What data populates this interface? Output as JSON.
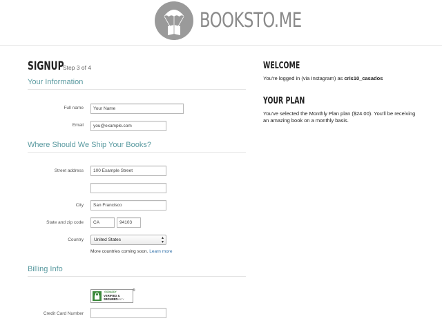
{
  "brand": {
    "name": "BOOKSTO.ME",
    "top_right": "' ' '"
  },
  "signup": {
    "title": "SIGNUP",
    "step": "Step 3 of 4"
  },
  "sections": {
    "info": "Your Information",
    "ship": "Where Should We Ship Your Books?",
    "billing": "Billing Info"
  },
  "fields": {
    "full_name": {
      "label": "Full name",
      "placeholder": "Your Name"
    },
    "email": {
      "label": "Email",
      "placeholder": "you@example.com"
    },
    "street": {
      "label": "Street address",
      "placeholder": "100 Example Street",
      "placeholder2": ""
    },
    "city": {
      "label": "City",
      "placeholder": "San Francisco"
    },
    "state_zip": {
      "label": "State and zip code",
      "state_placeholder": "CA",
      "zip_placeholder": "94103"
    },
    "country": {
      "label": "Country",
      "value": "United States"
    },
    "country_note": "More countries coming soon.",
    "learn_more": "Learn more",
    "card_number": {
      "label": "Credit Card Number",
      "placeholder": ""
    }
  },
  "badge": {
    "line1": "GODADDY",
    "line2": "VERIFIED & SECURED",
    "line3": "VERIFY SECURITY",
    "reg": "®"
  },
  "welcome": {
    "title": "WELCOME",
    "text_prefix": "You're logged in (via Instagram) as ",
    "username": "cris10_casados"
  },
  "plan": {
    "title": "YOUR PLAN",
    "text": "You've selected the Monthly Plan plan ($24.00). You'll be receiving an amazing book on a monthly basis."
  },
  "colors": {
    "accent": "#5a9aa0",
    "link": "#2f6fa8",
    "logo_grey": "#9a9a9a",
    "badge_green": "#3c8a3c"
  }
}
